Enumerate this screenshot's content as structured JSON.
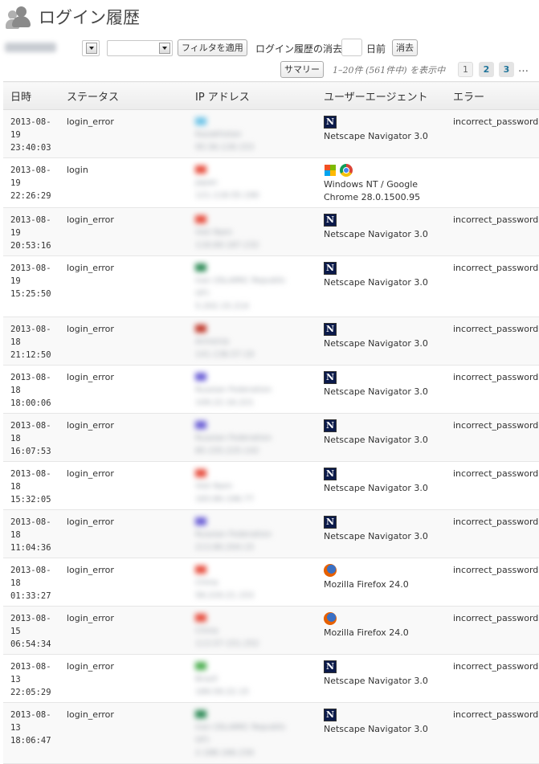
{
  "header": {
    "title": "ログイン履歴"
  },
  "filter": {
    "filter_button": "フィルタを適用",
    "delete_label": "ログイン履歴の消去",
    "days_label": "日前",
    "delete_button": "消去"
  },
  "paging": {
    "summary_button": "サマリー",
    "displaying": "1–20件 (561件中) を表示中",
    "pages": [
      "1",
      "2",
      "3"
    ],
    "current_page": "1",
    "ellipsis": "…"
  },
  "table": {
    "columns": [
      "日時",
      "ステータス",
      "IP アドレス",
      "ユーザーエージェント",
      "エラー"
    ],
    "rows": [
      {
        "date": "2013-08-",
        "time": "19 23:40:03",
        "status": "login_error",
        "ua_icons": [
          "netscape-icon"
        ],
        "ua": "Netscape Navigator 3.0",
        "ua2": "",
        "error": "incorrect_password"
      },
      {
        "date": "2013-08-",
        "time": "19 22:26:29",
        "status": "login",
        "ua_icons": [
          "windows-icon",
          "chrome-icon"
        ],
        "ua": "Windows NT / Google",
        "ua2": "Chrome 28.0.1500.95",
        "error": ""
      },
      {
        "date": "2013-08-",
        "time": "19 20:53:16",
        "status": "login_error",
        "ua_icons": [
          "netscape-icon"
        ],
        "ua": "Netscape Navigator 3.0",
        "ua2": "",
        "error": "incorrect_password"
      },
      {
        "date": "2013-08-",
        "time": "19 15:25:50",
        "status": "login_error",
        "ua_icons": [
          "netscape-icon"
        ],
        "ua": "Netscape Navigator 3.0",
        "ua2": "",
        "error": "incorrect_password"
      },
      {
        "date": "2013-08-",
        "time": "18 21:12:50",
        "status": "login_error",
        "ua_icons": [
          "netscape-icon"
        ],
        "ua": "Netscape Navigator 3.0",
        "ua2": "",
        "error": "incorrect_password"
      },
      {
        "date": "2013-08-",
        "time": "18 18:00:06",
        "status": "login_error",
        "ua_icons": [
          "netscape-icon"
        ],
        "ua": "Netscape Navigator 3.0",
        "ua2": "",
        "error": "incorrect_password"
      },
      {
        "date": "2013-08-",
        "time": "18 16:07:53",
        "status": "login_error",
        "ua_icons": [
          "netscape-icon"
        ],
        "ua": "Netscape Navigator 3.0",
        "ua2": "",
        "error": "incorrect_password"
      },
      {
        "date": "2013-08-",
        "time": "18 15:32:05",
        "status": "login_error",
        "ua_icons": [
          "netscape-icon"
        ],
        "ua": "Netscape Navigator 3.0",
        "ua2": "",
        "error": "incorrect_password"
      },
      {
        "date": "2013-08-",
        "time": "18 11:04:36",
        "status": "login_error",
        "ua_icons": [
          "netscape-icon"
        ],
        "ua": "Netscape Navigator 3.0",
        "ua2": "",
        "error": "incorrect_password"
      },
      {
        "date": "2013-08-",
        "time": "18 01:33:27",
        "status": "login_error",
        "ua_icons": [
          "firefox-icon"
        ],
        "ua": "Mozilla Firefox 24.0",
        "ua2": "",
        "error": "incorrect_password"
      },
      {
        "date": "2013-08-",
        "time": "15 06:54:34",
        "status": "login_error",
        "ua_icons": [
          "firefox-icon"
        ],
        "ua": "Mozilla Firefox 24.0",
        "ua2": "",
        "error": "incorrect_password"
      },
      {
        "date": "2013-08-",
        "time": "13 22:05:29",
        "status": "login_error",
        "ua_icons": [
          "netscape-icon"
        ],
        "ua": "Netscape Navigator 3.0",
        "ua2": "",
        "error": "incorrect_password"
      },
      {
        "date": "2013-08-",
        "time": "13 18:06:47",
        "status": "login_error",
        "ua_icons": [
          "netscape-icon"
        ],
        "ua": "Netscape Navigator 3.0",
        "ua2": "",
        "error": "incorrect_password"
      }
    ]
  },
  "colors": {
    "link": "#21759b",
    "row_alt": "#f9f9f9",
    "netscape": "#0b1a4a"
  }
}
